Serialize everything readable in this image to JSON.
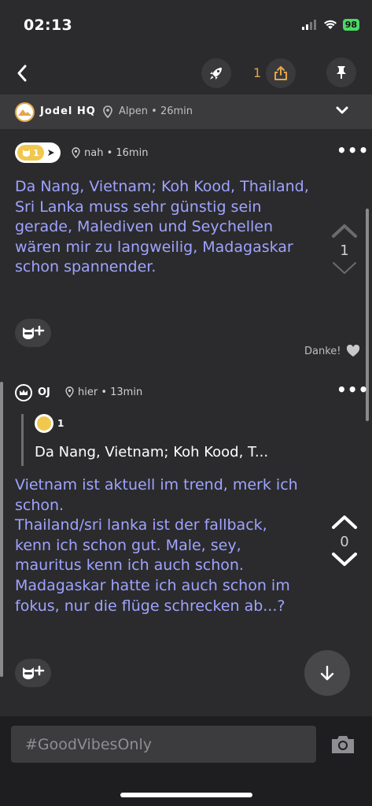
{
  "status": {
    "time": "02:13",
    "battery": "98"
  },
  "nav": {
    "share_count": "1"
  },
  "channel": {
    "name": "Jodel HQ",
    "location": "Alpen",
    "age": "• 26min"
  },
  "post1": {
    "badge_num": "1",
    "location": "nah",
    "age": "• 16min",
    "text": "Da Nang, Vietnam; Koh Kood, Thailand, Sri Lanka muss sehr günstig sein gerade, Malediven und Seychellen wären mir zu langweilig, Madagaskar schon spannender.",
    "votes": "1",
    "thanks_label": "Danke!"
  },
  "post2": {
    "author": "OJ",
    "location": "hier",
    "age": "• 13min",
    "quote_num": "1",
    "quote_text": "Da Nang, Vietnam; Koh Kood, T...",
    "text_lines": [
      "Vietnam ist aktuell im trend, merk ich",
      "schon.",
      "Thailand/sri lanka ist der fallback,",
      "kenn ich schon gut. Male, sey,",
      "mauritus kenn ich auch schon.",
      "Madagaskar hatte ich auch schon im",
      "fokus, nur die flüge schrecken ab...?"
    ],
    "votes": "0"
  },
  "composer": {
    "placeholder": "#GoodVibesOnly"
  },
  "colors": {
    "accent": "#e5a64a",
    "post_text": "#9fa3ff",
    "badge": "#f1c84e"
  }
}
